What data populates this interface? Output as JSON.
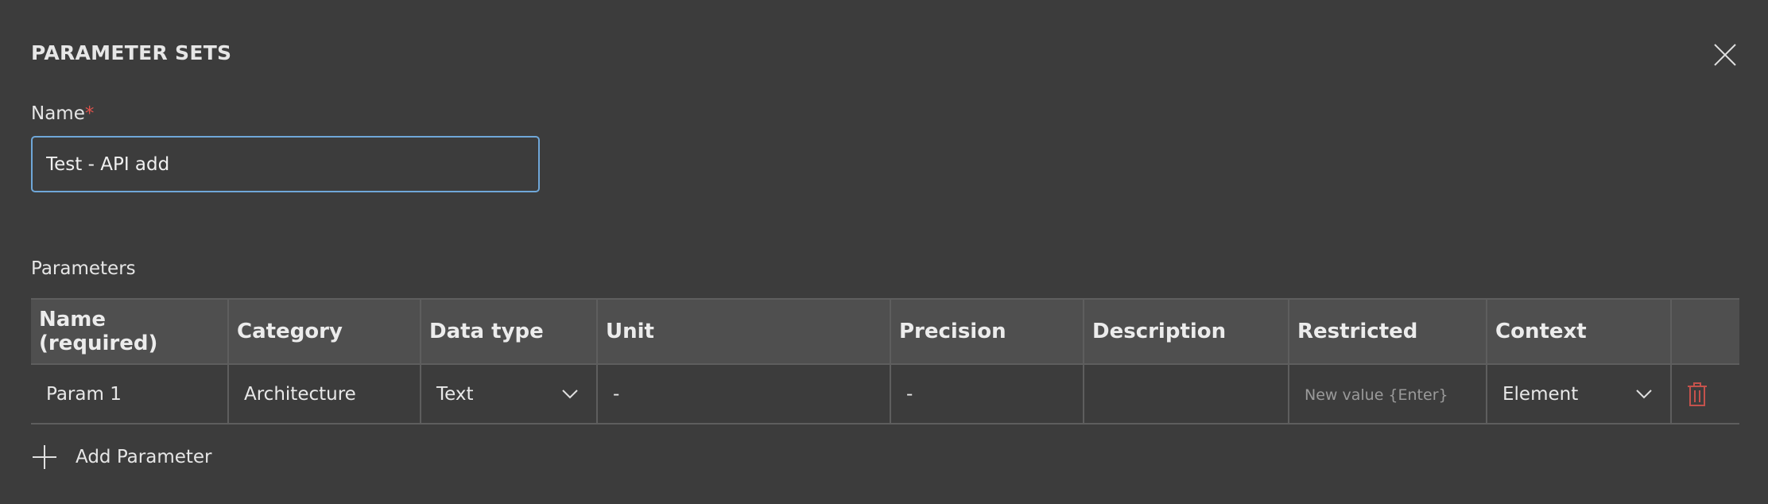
{
  "dialog": {
    "title": "PARAMETER SETS",
    "close_icon": "close-icon"
  },
  "name_field": {
    "label": "Name",
    "required_marker": "*",
    "value": "Test - API add"
  },
  "parameters": {
    "label": "Parameters",
    "columns": [
      "Name (required)",
      "Category",
      "Data type",
      "Unit",
      "Precision",
      "Description",
      "Restricted",
      "Context",
      ""
    ],
    "rows": [
      {
        "name": "Param 1",
        "category": "Architecture",
        "data_type": "Text",
        "unit": "-",
        "precision": "-",
        "description": "",
        "restricted_placeholder": "New value {Enter}",
        "context": "Element"
      }
    ],
    "add_label": "Add Parameter"
  },
  "colors": {
    "background": "#3c3c3c",
    "header_bg": "#4f4f4f",
    "focus_border": "#6fa7d8",
    "required": "#e0524b",
    "delete_icon": "#c4524c"
  }
}
